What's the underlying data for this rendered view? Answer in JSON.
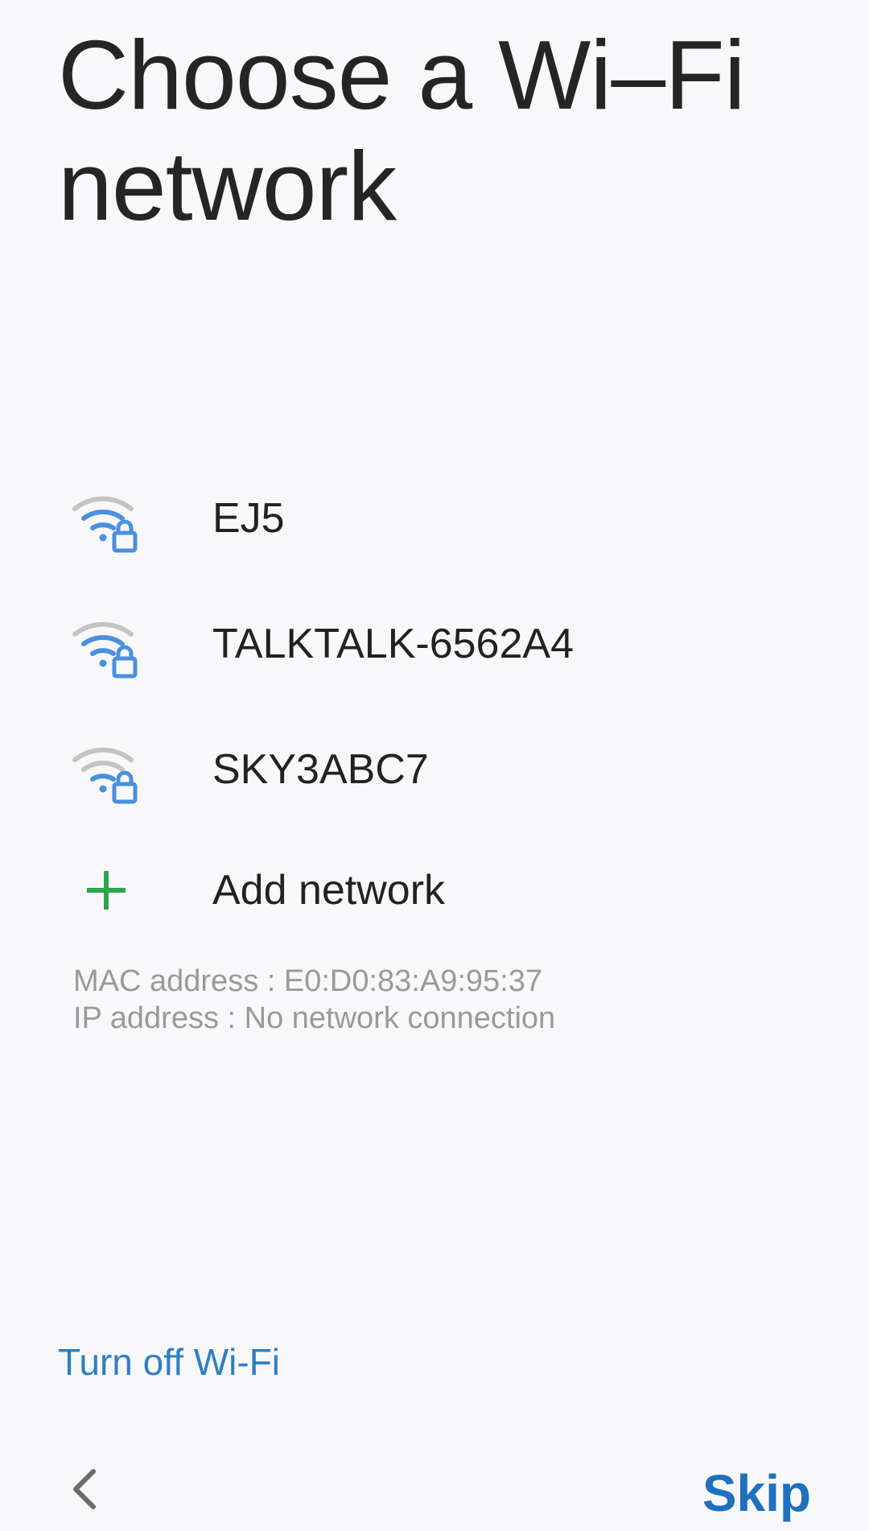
{
  "header": {
    "title": "Choose a Wi–Fi network"
  },
  "networks": [
    {
      "ssid": "EJ5",
      "icon": "wifi-locked-icon"
    },
    {
      "ssid": "TALKTALK-6562A4",
      "icon": "wifi-locked-icon"
    },
    {
      "ssid": "SKY3ABC7",
      "icon": "wifi-locked-icon"
    }
  ],
  "add_network": {
    "label": "Add network",
    "icon": "plus-icon"
  },
  "info": {
    "mac": "MAC address : E0:D0:83:A9:95:37",
    "ip": "IP address : No network connection"
  },
  "actions": {
    "turn_off": "Turn off Wi-Fi",
    "skip": "Skip",
    "back_icon": "chevron-left-icon"
  },
  "colors": {
    "accent": "#1f70bd",
    "link": "#2f7fc1",
    "wifi_icon": "#4a8fe0",
    "wifi_weak": "#c4c4c4",
    "plus": "#2ea44f",
    "secondary_text": "#9a9a9a",
    "background": "#f8f8fa"
  }
}
